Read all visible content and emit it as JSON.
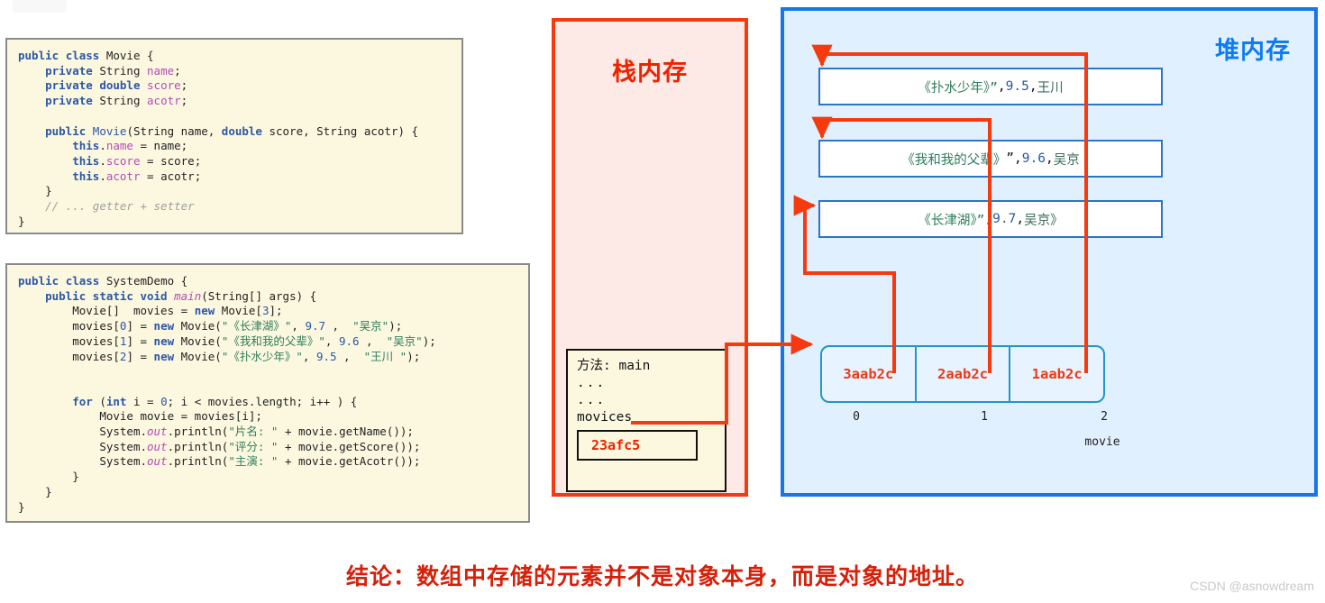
{
  "code_blocks": [
    {
      "id": "movie-class",
      "lines": [
        "public class Movie {",
        "    private String name;",
        "    private double score;",
        "    private String acotr;",
        "",
        "    public Movie(String name, double score, String acotr) {",
        "        this.name = name;",
        "        this.score = score;",
        "        this.acotr = acotr;",
        "    }",
        "    // ... getter + setter",
        "}"
      ]
    },
    {
      "id": "systemdemo-class",
      "lines": [
        "public class SystemDemo {",
        "    public static void main(String[] args) {",
        "        Movie[]  movies = new Movie[3];",
        "        movies[0] = new Movie(\"《长津湖》\", 9.7 ,  \"吴京\");",
        "        movies[1] = new Movie(\"《我和我的父辈》\", 9.6 ,  \"吴京\");",
        "        movies[2] = new Movie(\"《扑水少年》\", 9.5 ,  \"王川 \");",
        "",
        "",
        "        for (int i = 0; i < movies.length; i++ ) {",
        "            Movie movie = movies[i];",
        "            System.out.println(\"片名: \" + movie.getName());",
        "            System.out.println(\"评分: \" + movie.getScore());",
        "            System.out.println(\"主演: \" + movie.getAcotr());",
        "        }",
        "    }",
        "}"
      ]
    }
  ],
  "stack": {
    "title": "栈内存",
    "frame": {
      "method_label": "方法: main",
      "dots1": "...",
      "dots2": "...",
      "variable": "movices",
      "address_value": "23afc5"
    }
  },
  "heap": {
    "title": "堆内存",
    "objects": [
      {
        "name": "《扑水少年》”",
        "sep1": ", ",
        "score": "9.5",
        "sep2": " , ",
        "actor": "王川"
      },
      {
        "name": "《我和我的父辈》",
        "sep1": " ”, ",
        "score": "9.6",
        "sep2": " , ",
        "actor": "吴京"
      },
      {
        "name": "《长津湖》”",
        "sep1": ", ",
        "score": "9.7",
        "sep2": " , ",
        "actor": "吴京》"
      }
    ],
    "array": {
      "name": "movie",
      "cells": [
        "3aab2c",
        "2aab2c",
        "1aab2c"
      ],
      "indices": [
        "0",
        "1",
        "2"
      ]
    }
  },
  "conclusion": "结论：数组中存储的元素并不是对象本身，而是对象的地址。",
  "watermark": "CSDN @asnowdream",
  "colors": {
    "stack_accent": "#ED2300",
    "heap_accent": "#0C7BF5",
    "arrow": "#F63A0F",
    "address_text": "#ED3A18",
    "conclusion": "#D6200A",
    "code_bg": "#FCF8E0",
    "stack_bg": "#FDE9E5",
    "heap_bg": "#E1F0FE"
  }
}
